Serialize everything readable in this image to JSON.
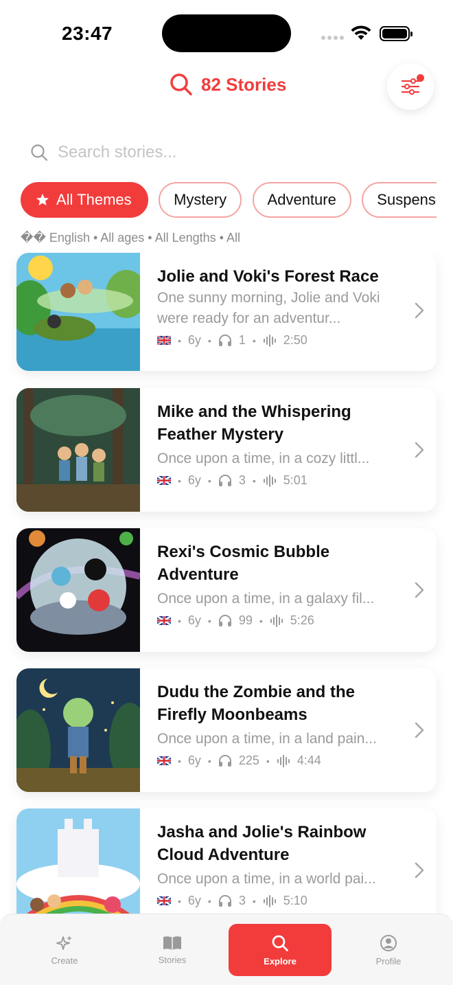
{
  "status_bar": {
    "time": "23:47"
  },
  "header": {
    "count_label": "82 Stories"
  },
  "search": {
    "placeholder": "Search stories..."
  },
  "themes": [
    {
      "label": "All Themes",
      "active": true
    },
    {
      "label": "Mystery",
      "active": false
    },
    {
      "label": "Adventure",
      "active": false
    },
    {
      "label": "Suspense",
      "active": false
    }
  ],
  "filter_summary": "�� English • All ages • All Lengths • All",
  "stories": [
    {
      "title": "Jolie and Voki's Forest Race",
      "excerpt": "One sunny morning, Jolie and Voki were ready for an adventur...",
      "age": "6y",
      "listens": "1",
      "duration": "2:50"
    },
    {
      "title": "Mike and the Whispering Feather Mystery",
      "excerpt": "Once upon a time, in a cozy littl...",
      "age": "6y",
      "listens": "3",
      "duration": "5:01"
    },
    {
      "title": "Rexi's Cosmic Bubble Adventure",
      "excerpt": "Once upon a time, in a galaxy fil...",
      "age": "6y",
      "listens": "99",
      "duration": "5:26"
    },
    {
      "title": "Dudu the Zombie and the Firefly Moonbeams",
      "excerpt": "Once upon a time, in a land pain...",
      "age": "6y",
      "listens": "225",
      "duration": "4:44"
    },
    {
      "title": "Jasha and Jolie's Rainbow Cloud Adventure",
      "excerpt": "Once upon a time, in a world pai...",
      "age": "6y",
      "listens": "3",
      "duration": "5:10"
    }
  ],
  "tabs": [
    {
      "label": "Create",
      "icon": "sparkles-icon"
    },
    {
      "label": "Stories",
      "icon": "book-icon"
    },
    {
      "label": "Explore",
      "icon": "search-icon",
      "active": true
    },
    {
      "label": "Profile",
      "icon": "person-circle-icon"
    }
  ],
  "colors": {
    "accent": "#f23c3c",
    "chip_border": "#f4a3a3",
    "muted_text": "#9a9a9a"
  }
}
